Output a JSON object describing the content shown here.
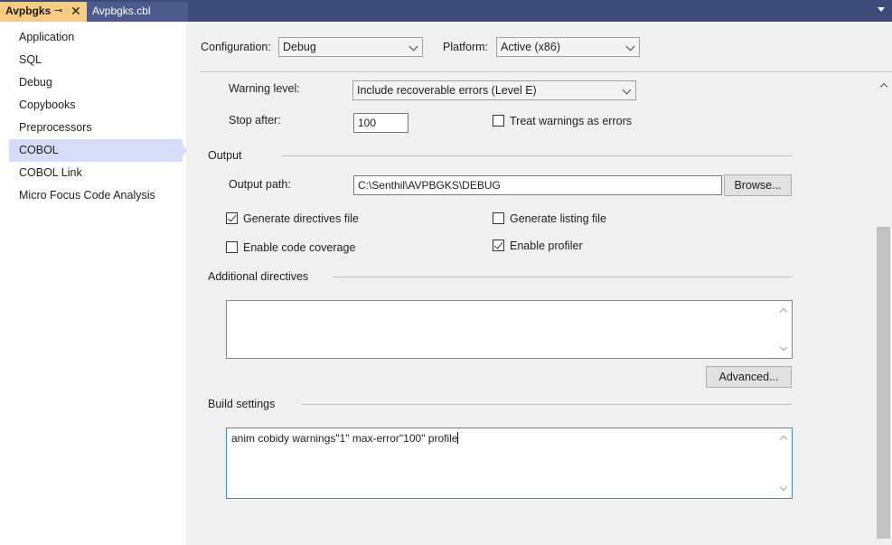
{
  "tabs": [
    {
      "label": "Avpbgks",
      "pin": "⊸",
      "close": "✕"
    },
    {
      "label": "Avpbgks.cbl"
    }
  ],
  "sidebar": {
    "items": [
      {
        "label": "Application"
      },
      {
        "label": "SQL"
      },
      {
        "label": "Debug"
      },
      {
        "label": "Copybooks"
      },
      {
        "label": "Preprocessors"
      },
      {
        "label": "COBOL"
      },
      {
        "label": "COBOL Link"
      },
      {
        "label": "Micro Focus Code Analysis"
      }
    ],
    "selected": "COBOL"
  },
  "config": {
    "configuration_label": "Configuration:",
    "configuration_value": "Debug",
    "platform_label": "Platform:",
    "platform_value": "Active (x86)"
  },
  "warnings": {
    "warning_level_label": "Warning level:",
    "warning_level_value": "Include recoverable errors (Level E)",
    "stop_after_label": "Stop after:",
    "stop_after_value": "100",
    "treat_warnings_label": "Treat warnings as errors",
    "treat_warnings_checked": false
  },
  "output": {
    "section_title": "Output",
    "output_path_label": "Output path:",
    "output_path_value": "C:\\Senthil\\AVPBGKS\\DEBUG",
    "browse_label": "Browse...",
    "generate_directives_label": "Generate directives file",
    "generate_directives_checked": true,
    "generate_listing_label": "Generate listing file",
    "generate_listing_checked": false,
    "code_coverage_label": "Enable code coverage",
    "code_coverage_checked": false,
    "profiler_label": "Enable profiler",
    "profiler_checked": true
  },
  "additional": {
    "section_title": "Additional directives",
    "value": "",
    "advanced_label": "Advanced..."
  },
  "build": {
    "section_title": "Build settings",
    "value": "anim cobidy warnings\"1\" max-error\"100\" profile"
  },
  "colors": {
    "tabstrip": "#3c4a78",
    "active_tab": "#f5cc84",
    "selected_nav": "#d6dcf5",
    "focus_border": "#3f8ac4"
  }
}
